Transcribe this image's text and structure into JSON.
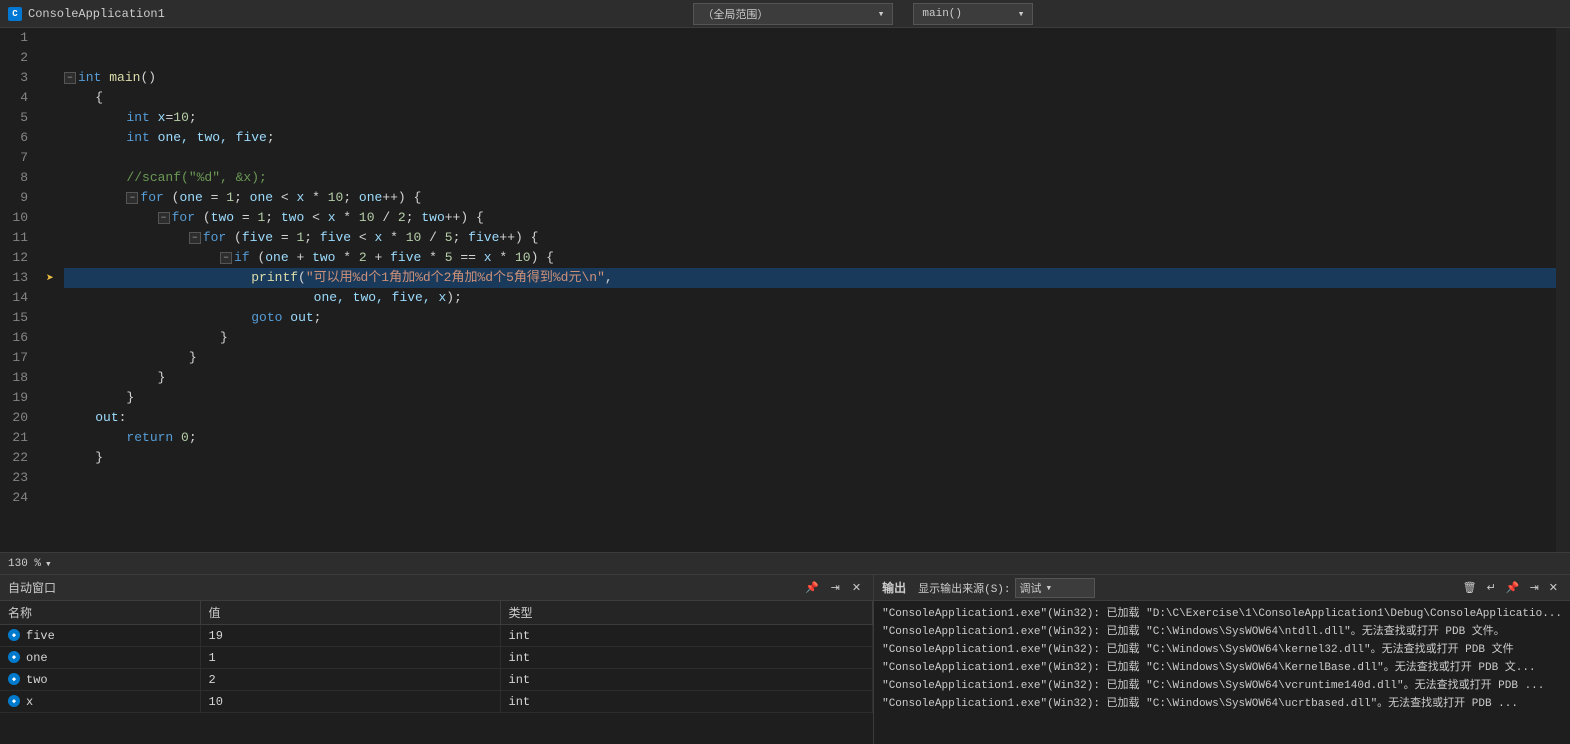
{
  "topbar": {
    "title": "ConsoleApplication1",
    "icon": "C",
    "scopeLabel": "（全局范围）",
    "functionLabel": "main()"
  },
  "editor": {
    "lines": [
      {
        "num": 1,
        "content": "",
        "tokens": []
      },
      {
        "num": 2,
        "content": "",
        "tokens": []
      },
      {
        "num": 3,
        "content": "⊟int main()",
        "tokens": [
          {
            "text": "⊟",
            "cls": "fold"
          },
          {
            "text": "int",
            "cls": "kw"
          },
          {
            "text": " ",
            "cls": ""
          },
          {
            "text": "main",
            "cls": "fn"
          },
          {
            "text": "()",
            "cls": "punct"
          }
        ],
        "fold": true
      },
      {
        "num": 4,
        "content": "    {",
        "tokens": [
          {
            "text": "    {",
            "cls": "punct"
          }
        ],
        "indent": 1
      },
      {
        "num": 5,
        "content": "        int x=10;",
        "tokens": [
          {
            "text": "        "
          },
          {
            "text": "int",
            "cls": "kw"
          },
          {
            "text": " ",
            "cls": ""
          },
          {
            "text": "x",
            "cls": "var"
          },
          {
            "text": "=",
            "cls": "op"
          },
          {
            "text": "10",
            "cls": "num"
          },
          {
            "text": ";",
            "cls": "punct"
          }
        ],
        "indent": 2
      },
      {
        "num": 6,
        "content": "        int one, two, five;",
        "tokens": [
          {
            "text": "        "
          },
          {
            "text": "int",
            "cls": "kw"
          },
          {
            "text": " ",
            "cls": ""
          },
          {
            "text": "one, two, five",
            "cls": "var"
          },
          {
            "text": ";",
            "cls": "punct"
          }
        ],
        "indent": 2
      },
      {
        "num": 7,
        "content": "",
        "tokens": []
      },
      {
        "num": 8,
        "content": "        //scanf(\"%d\", &x);",
        "tokens": [
          {
            "text": "        //scanf(\"%d\", &x);",
            "cls": "cmt"
          }
        ],
        "indent": 2
      },
      {
        "num": 9,
        "content": "⊟       for (one = 1; one < x * 10; one++) {",
        "tokens": [
          {
            "text": "        "
          },
          {
            "text": "⊟",
            "cls": "fold"
          },
          {
            "text": "for",
            "cls": "kw"
          },
          {
            "text": " (",
            "cls": "punct"
          },
          {
            "text": "one",
            "cls": "var"
          },
          {
            "text": " = ",
            "cls": "op"
          },
          {
            "text": "1",
            "cls": "num"
          },
          {
            "text": "; ",
            "cls": "punct"
          },
          {
            "text": "one",
            "cls": "var"
          },
          {
            "text": " < ",
            "cls": "op"
          },
          {
            "text": "x",
            "cls": "var"
          },
          {
            "text": " * ",
            "cls": "op"
          },
          {
            "text": "10",
            "cls": "num"
          },
          {
            "text": "; ",
            "cls": "punct"
          },
          {
            "text": "one",
            "cls": "var"
          },
          {
            "text": "++) {",
            "cls": "punct"
          }
        ],
        "fold": true
      },
      {
        "num": 10,
        "content": "⊟           for (two = 1; two < x * 10 / 2; two++) {",
        "tokens": [
          {
            "text": "            "
          },
          {
            "text": "⊟",
            "cls": "fold"
          },
          {
            "text": "for",
            "cls": "kw"
          },
          {
            "text": " (",
            "cls": "punct"
          },
          {
            "text": "two",
            "cls": "var"
          },
          {
            "text": " = ",
            "cls": "op"
          },
          {
            "text": "1",
            "cls": "num"
          },
          {
            "text": "; ",
            "cls": "punct"
          },
          {
            "text": "two",
            "cls": "var"
          },
          {
            "text": " < ",
            "cls": "op"
          },
          {
            "text": "x",
            "cls": "var"
          },
          {
            "text": " * ",
            "cls": "op"
          },
          {
            "text": "10",
            "cls": "num"
          },
          {
            "text": " / ",
            "cls": "op"
          },
          {
            "text": "2",
            "cls": "num"
          },
          {
            "text": "; ",
            "cls": "punct"
          },
          {
            "text": "two",
            "cls": "var"
          },
          {
            "text": "++) {",
            "cls": "punct"
          }
        ],
        "fold": true
      },
      {
        "num": 11,
        "content": "⊟               for (five = 1; five < x * 10 / 5; five++) {",
        "tokens": [
          {
            "text": "                "
          },
          {
            "text": "⊟",
            "cls": "fold"
          },
          {
            "text": "for",
            "cls": "kw"
          },
          {
            "text": " (",
            "cls": "punct"
          },
          {
            "text": "five",
            "cls": "var"
          },
          {
            "text": " = ",
            "cls": "op"
          },
          {
            "text": "1",
            "cls": "num"
          },
          {
            "text": "; ",
            "cls": "punct"
          },
          {
            "text": "five",
            "cls": "var"
          },
          {
            "text": " < ",
            "cls": "op"
          },
          {
            "text": "x",
            "cls": "var"
          },
          {
            "text": " * ",
            "cls": "op"
          },
          {
            "text": "10",
            "cls": "num"
          },
          {
            "text": " / ",
            "cls": "op"
          },
          {
            "text": "5",
            "cls": "num"
          },
          {
            "text": "; ",
            "cls": "punct"
          },
          {
            "text": "five",
            "cls": "var"
          },
          {
            "text": "++) {",
            "cls": "punct"
          }
        ],
        "fold": true
      },
      {
        "num": 12,
        "content": "⊟                   if (one + two * 2 + five * 5 == x * 10) {",
        "tokens": [
          {
            "text": "                    "
          },
          {
            "text": "⊟",
            "cls": "fold"
          },
          {
            "text": "if",
            "cls": "kw"
          },
          {
            "text": " (",
            "cls": "punct"
          },
          {
            "text": "one",
            "cls": "var"
          },
          {
            "text": " + ",
            "cls": "op"
          },
          {
            "text": "two",
            "cls": "var"
          },
          {
            "text": " * ",
            "cls": "op"
          },
          {
            "text": "2",
            "cls": "num"
          },
          {
            "text": " + ",
            "cls": "op"
          },
          {
            "text": "five",
            "cls": "var"
          },
          {
            "text": " * ",
            "cls": "op"
          },
          {
            "text": "5",
            "cls": "num"
          },
          {
            "text": " == ",
            "cls": "op"
          },
          {
            "text": "x",
            "cls": "var"
          },
          {
            "text": " * ",
            "cls": "op"
          },
          {
            "text": "10",
            "cls": "num"
          },
          {
            "text": ") {",
            "cls": "punct"
          }
        ],
        "fold": true
      },
      {
        "num": 13,
        "content": "                        printf(\"可以用%d个1角加%d个2角加%d个5角得到%d元\\n\",",
        "tokens": [
          {
            "text": "                        "
          },
          {
            "text": "printf",
            "cls": "fn"
          },
          {
            "text": "(",
            "cls": "punct"
          },
          {
            "text": "\"可以用%d个1角加%d个2角加%d个5角得到%d元\\n\"",
            "cls": "str"
          },
          {
            "text": ",",
            "cls": "punct"
          }
        ],
        "debug": true,
        "highlighted": true
      },
      {
        "num": 14,
        "content": "                                one, two, five, x);",
        "tokens": [
          {
            "text": "                                "
          },
          {
            "text": "one, two, five, x",
            "cls": "var"
          },
          {
            "text": ");",
            "cls": "punct"
          }
        ]
      },
      {
        "num": 15,
        "content": "                        goto out;",
        "tokens": [
          {
            "text": "                        "
          },
          {
            "text": "goto",
            "cls": "kw"
          },
          {
            "text": " ",
            "cls": ""
          },
          {
            "text": "out",
            "cls": "var"
          },
          {
            "text": ";",
            "cls": "punct"
          }
        ]
      },
      {
        "num": 16,
        "content": "                    }",
        "tokens": [
          {
            "text": "                    }",
            "cls": "punct"
          }
        ]
      },
      {
        "num": 17,
        "content": "                }",
        "tokens": [
          {
            "text": "                }",
            "cls": "punct"
          }
        ]
      },
      {
        "num": 18,
        "content": "            }",
        "tokens": [
          {
            "text": "            }",
            "cls": "punct"
          }
        ]
      },
      {
        "num": 19,
        "content": "        }",
        "tokens": [
          {
            "text": "        }",
            "cls": "punct"
          }
        ]
      },
      {
        "num": 20,
        "content": "    out:",
        "tokens": [
          {
            "text": "    "
          },
          {
            "text": "out",
            "cls": "var"
          },
          {
            "text": ":",
            "cls": "punct"
          }
        ]
      },
      {
        "num": 21,
        "content": "        return 0;",
        "tokens": [
          {
            "text": "        "
          },
          {
            "text": "return",
            "cls": "kw"
          },
          {
            "text": " ",
            "cls": ""
          },
          {
            "text": "0",
            "cls": "num"
          },
          {
            "text": ";",
            "cls": "punct"
          }
        ]
      },
      {
        "num": 22,
        "content": "    }",
        "tokens": [
          {
            "text": "    }",
            "cls": "punct"
          }
        ]
      },
      {
        "num": 23,
        "content": "",
        "tokens": []
      },
      {
        "num": 24,
        "content": "",
        "tokens": []
      }
    ]
  },
  "statusbar": {
    "zoom": "130 %",
    "zoomArrow": "▾"
  },
  "autosPanel": {
    "title": "自动窗口",
    "columns": [
      "名称",
      "值",
      "类型"
    ],
    "rows": [
      {
        "name": "five",
        "value": "19",
        "type": "int"
      },
      {
        "name": "one",
        "value": "1",
        "type": "int"
      },
      {
        "name": "two",
        "value": "2",
        "type": "int"
      },
      {
        "name": "x",
        "value": "10",
        "type": "int"
      }
    ]
  },
  "outputPanel": {
    "title": "输出",
    "sourceLabel": "显示输出来源(S):",
    "sourceValue": "调试",
    "lines": [
      "\"ConsoleApplication1.exe\"(Win32): 已加载 \"D:\\C\\Exercise\\1\\ConsoleApplication1\\Debug\\ConsoleApplicatio...",
      "\"ConsoleApplication1.exe\"(Win32): 已加载 \"C:\\Windows\\SysWOW64\\ntdll.dll\"。无法查找或打开 PDB 文件。",
      "\"ConsoleApplication1.exe\"(Win32): 已加载 \"C:\\Windows\\SysWOW64\\kernel32.dll\"。无法查找或打开 PDB 文件",
      "\"ConsoleApplication1.exe\"(Win32): 已加载 \"C:\\Windows\\SysWOW64\\KernelBase.dll\"。无法查找或打开 PDB 文...",
      "\"ConsoleApplication1.exe\"(Win32): 已加载 \"C:\\Windows\\SysWOW64\\vcruntime140d.dll\"。无法查找或打开 PDB ...",
      "\"ConsoleApplication1.exe\"(Win32): 已加载 \"C:\\Windows\\SysWOW64\\ucrtbased.dll\"。无法查找或打开 PDB ..."
    ]
  }
}
